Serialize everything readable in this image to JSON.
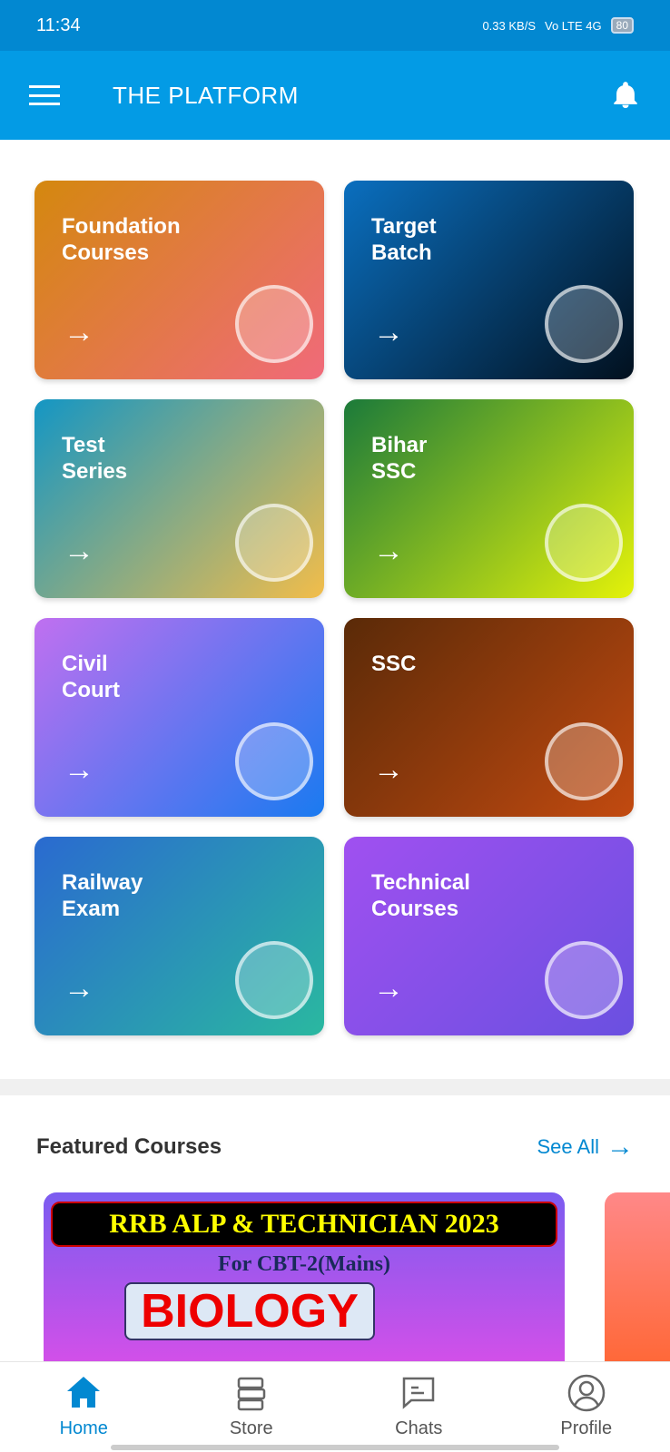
{
  "status": {
    "time": "11:34",
    "speed": "0.33 KB/S",
    "net": "Vo LTE 4G",
    "battery": "80"
  },
  "appbar": {
    "title": "THE PLATFORM"
  },
  "categories": [
    {
      "label": "Foundation\nCourses",
      "bg": "linear-gradient(135deg,#d4880e,#f06a7a)",
      "icon": "monitor-graduation-icon"
    },
    {
      "label": "Target\nBatch",
      "bg": "linear-gradient(135deg,#0a6fbf,#02101e)",
      "icon": "target-icon"
    },
    {
      "label": "Test\nSeries",
      "bg": "linear-gradient(135deg,#1496c4,#f2bd4a)",
      "icon": "checklist-icon"
    },
    {
      "label": "Bihar\nSSC",
      "bg": "linear-gradient(135deg,#1b7a3a,#e4f20a)",
      "icon": "bihar-ssc-logo-icon"
    },
    {
      "label": "Civil\nCourt",
      "bg": "linear-gradient(135deg,#c070f0,#1a7af0)",
      "icon": "scales-icon"
    },
    {
      "label": "SSC",
      "bg": "linear-gradient(135deg,#5a2a08,#c24a10)",
      "icon": "ssc-emblem-icon"
    },
    {
      "label": "Railway\nExam",
      "bg": "linear-gradient(135deg,#2a6ad0,#2ab8a0)",
      "icon": "indian-railways-icon"
    },
    {
      "label": "Technical\nCourses",
      "bg": "linear-gradient(135deg,#a050f0,#6a50e0)",
      "icon": "book-gear-icon"
    }
  ],
  "featured": {
    "title": "Featured Courses",
    "see_all": "See All",
    "banner": {
      "line1": "RRB ALP & TECHNICIAN 2023",
      "line2": "For CBT-2(Mains)",
      "line3": "BIOLOGY"
    }
  },
  "nav": [
    {
      "label": "Home",
      "icon": "home-icon",
      "active": true
    },
    {
      "label": "Store",
      "icon": "books-icon"
    },
    {
      "label": "Chats",
      "icon": "chat-icon"
    },
    {
      "label": "Profile",
      "icon": "profile-icon"
    }
  ],
  "colors": {
    "primary": "#039be5",
    "status": "#0288d1"
  }
}
